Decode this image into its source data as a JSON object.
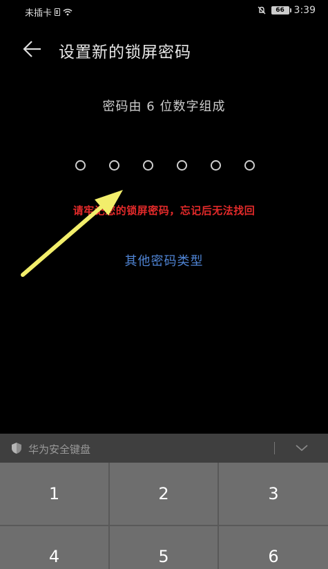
{
  "status_bar": {
    "carrier": "未插卡",
    "battery": "66",
    "time": "3:39",
    "icons": [
      "sim-icon",
      "wifi-icon",
      "mute-icon",
      "battery-icon"
    ]
  },
  "header": {
    "back_icon": "arrow-left-icon",
    "title": "设置新的锁屏密码"
  },
  "pin": {
    "hint": "密码由 6 位数字组成",
    "digits_total": 6,
    "digits_entered": 0
  },
  "warning": "请牢记您的锁屏密码，忘记后无法找回",
  "other_type_link": "其他密码类型",
  "annotation": {
    "arrow_color": "#f2ee6b"
  },
  "keyboard": {
    "shield_icon": "shield-icon",
    "title": "华为安全键盘",
    "collapse_icon": "chevron-down-icon",
    "keys": [
      "1",
      "2",
      "3",
      "4",
      "5",
      "6"
    ]
  },
  "colors": {
    "background": "#000000",
    "warning": "#e32a2a",
    "link": "#4f84d4",
    "key": "#6e6e6e"
  }
}
